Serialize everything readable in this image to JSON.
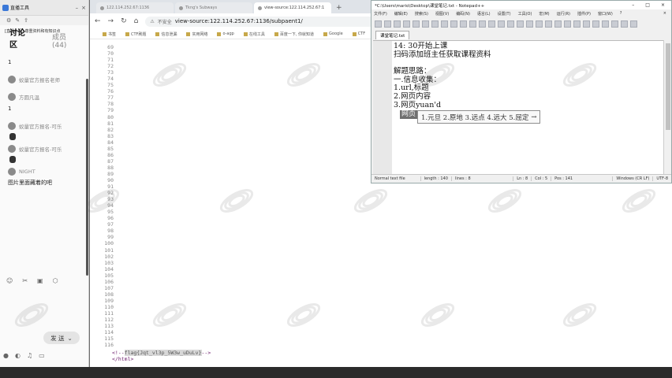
{
  "live": {
    "app_title": "直播工具",
    "course_title": "[直播小程] 尊重资料和有知识点",
    "tabs": {
      "discuss": "讨论区",
      "members": "成员(44)"
    },
    "chat": [
      {
        "type": "text",
        "text": "1"
      },
      {
        "type": "user",
        "name": "蚁量官方报名老师"
      },
      {
        "type": "user",
        "name": "方圆凡温"
      },
      {
        "type": "text",
        "text": "1"
      },
      {
        "type": "user",
        "name": "蚁量官方报名-可乐"
      },
      {
        "type": "user",
        "name": "蚁量官方报名-可乐"
      },
      {
        "type": "user",
        "name": "NIGHT"
      },
      {
        "type": "text",
        "text": "图片里面藏着的吧"
      }
    ],
    "send_label": "发 送",
    "tool_icons": [
      "emoji-icon",
      "scissors-icon",
      "image-icon",
      "gift-icon"
    ],
    "bottom_icons": [
      "mic-icon",
      "mute-icon",
      "music-icon",
      "screen-icon"
    ]
  },
  "browser": {
    "tabs": [
      {
        "label": "122.114.252.67:1136",
        "active": false
      },
      {
        "label": "Tkng's Subways",
        "active": false
      },
      {
        "label": "view-source:122.114.252.67:1",
        "active": true
      }
    ],
    "security_label": "不安全",
    "url": "view-source:122.114.252.67:1136/subpaent1/",
    "bookmarks": [
      "书签",
      "CTF刷题",
      "信息泄漏",
      "实用网络",
      "o-agp",
      "在线工具",
      "百度一下, 你就知道",
      "Google",
      "CTF"
    ],
    "line_numbers": [
      "69",
      "70",
      "71",
      "72",
      "73",
      "74",
      "75",
      "76",
      "77",
      "78",
      "79",
      "80",
      "81",
      "82",
      "83",
      "84",
      "85",
      "86",
      "87",
      "88",
      "89",
      "90",
      "91",
      "92",
      "93",
      "94",
      "95",
      "96",
      "97",
      "98",
      "99",
      "100",
      "101",
      "102",
      "103",
      "104",
      "105",
      "106",
      "107",
      "108",
      "109",
      "110",
      "111",
      "112",
      "113",
      "114",
      "115",
      "116"
    ],
    "code_comment_start": "<!--",
    "code_flag": "flag{Jqt_vl3p_5W3w_uDuLv}",
    "code_comment_end": "-->",
    "code_html_close": "</html>"
  },
  "notepad": {
    "title": "*C:\\Users\\mario\\Desktop\\课堂笔记.txt - Notepad++",
    "menu": [
      "文件(F)",
      "编辑(E)",
      "搜索(S)",
      "视图(V)",
      "编码(N)",
      "语言(L)",
      "设置(T)",
      "工具(O)",
      "宏(M)",
      "运行(R)",
      "插件(P)",
      "窗口(W)",
      "?"
    ],
    "file_tab": "课堂笔记.txt",
    "lines": [
      "14: 30开始上课",
      "扫码添加班主任获取课程资料",
      "",
      "解题思路：",
      "一.信息收集：",
      "1.url,标题",
      "2.网页内容",
      "3.网页yuan'd"
    ],
    "status": {
      "type": "Normal text file",
      "length": "length : 140",
      "lines": "lines : 8",
      "ln": "Ln : 8",
      "col": "Col : 5",
      "pos": "Pos : 141",
      "eol": "Windows (CR LF)",
      "enc": "UTF-8"
    },
    "ime_composition": "网页",
    "ime_candidates": "1.元旦 2.原地 3.远点 4.远大 5.屈定"
  }
}
